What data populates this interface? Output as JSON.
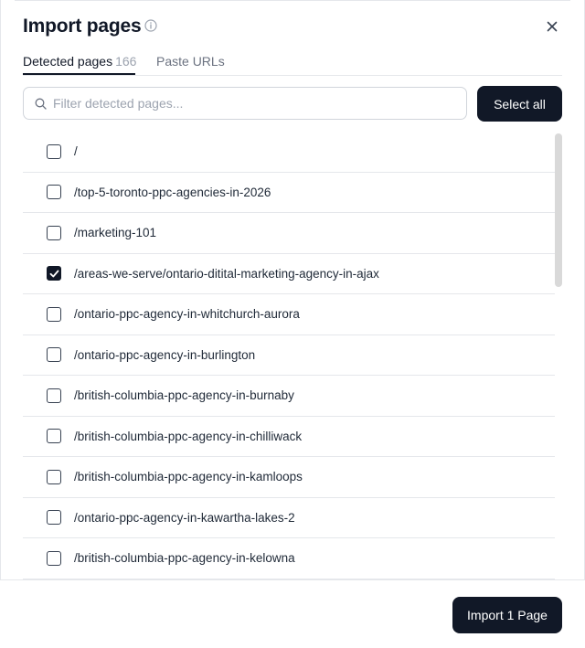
{
  "dialog": {
    "title": "Import pages",
    "close_icon": "close-icon",
    "info_icon": "info-icon"
  },
  "tabs": [
    {
      "label": "Detected pages",
      "count": "166",
      "active": true
    },
    {
      "label": "Paste URLs",
      "active": false
    }
  ],
  "search": {
    "placeholder": "Filter detected pages...",
    "value": "",
    "icon": "search-icon"
  },
  "select_all_label": "Select all",
  "pages": [
    {
      "path": "/",
      "checked": false
    },
    {
      "path": "/top-5-toronto-ppc-agencies-in-2026",
      "checked": false
    },
    {
      "path": "/marketing-101",
      "checked": false
    },
    {
      "path": "/areas-we-serve/ontario-ditital-marketing-agency-in-ajax",
      "checked": true
    },
    {
      "path": "/ontario-ppc-agency-in-whitchurch-aurora",
      "checked": false
    },
    {
      "path": "/ontario-ppc-agency-in-burlington",
      "checked": false
    },
    {
      "path": "/british-columbia-ppc-agency-in-burnaby",
      "checked": false
    },
    {
      "path": "/british-columbia-ppc-agency-in-chilliwack",
      "checked": false
    },
    {
      "path": "/british-columbia-ppc-agency-in-kamloops",
      "checked": false
    },
    {
      "path": "/ontario-ppc-agency-in-kawartha-lakes-2",
      "checked": false
    },
    {
      "path": "/british-columbia-ppc-agency-in-kelowna",
      "checked": false
    }
  ],
  "footer": {
    "import_label": "Import 1 Page"
  },
  "colors": {
    "primary": "#111827",
    "border": "#e5e7eb",
    "muted": "#9ca3af"
  }
}
